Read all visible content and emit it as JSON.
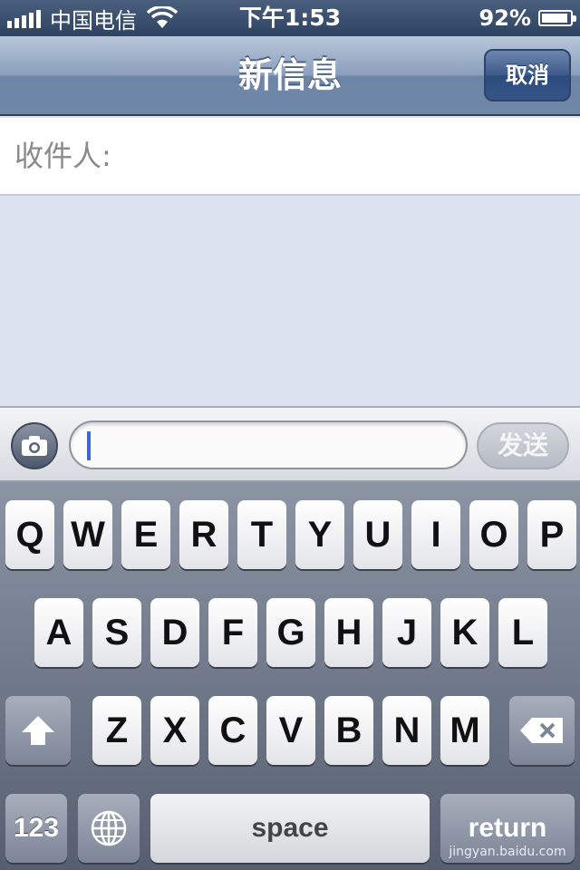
{
  "status_bar": {
    "carrier": "中国电信",
    "time": "下午1:53",
    "battery": "92%",
    "battery_level": 0.92,
    "signal_bars": 5
  },
  "nav": {
    "title": "新信息",
    "cancel_label": "取消"
  },
  "recipient": {
    "label": "收件人:"
  },
  "compose": {
    "text_value": "",
    "send_label": "发送"
  },
  "keyboard": {
    "row1": [
      "Q",
      "W",
      "E",
      "R",
      "T",
      "Y",
      "U",
      "I",
      "O",
      "P"
    ],
    "row2": [
      "A",
      "S",
      "D",
      "F",
      "G",
      "H",
      "J",
      "K",
      "L"
    ],
    "row3": [
      "Z",
      "X",
      "C",
      "V",
      "B",
      "N",
      "M"
    ],
    "num_label": "123",
    "space_label": "space",
    "return_label": "return"
  },
  "watermark": "jingyan.baidu.com",
  "colors": {
    "nav_accent": "#6d86a8",
    "caret": "#3b66e0"
  }
}
